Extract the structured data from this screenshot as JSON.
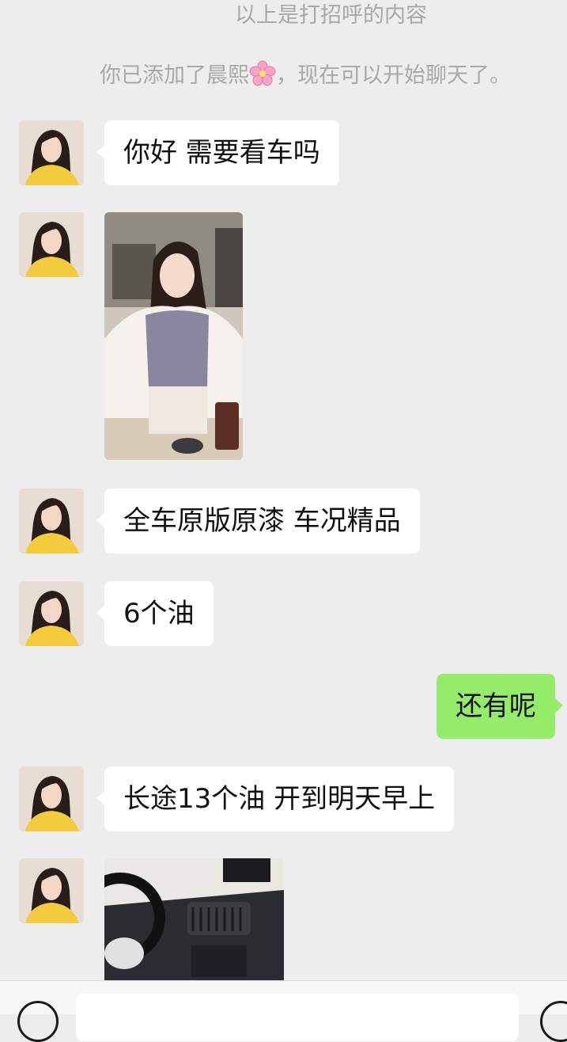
{
  "system": {
    "greeting_note": "以上是打招呼的内容",
    "added_prefix": "你已添加了晨熙",
    "added_emoji": "cherry-blossom-icon",
    "added_suffix": "，现在可以开始聊天了。"
  },
  "messages": [
    {
      "side": "left",
      "type": "text",
      "text": "你好  需要看车吗"
    },
    {
      "side": "left",
      "type": "image",
      "alt": "photo-woman-cafe"
    },
    {
      "side": "left",
      "type": "text",
      "text": "全车原版原漆  车况精品"
    },
    {
      "side": "left",
      "type": "text",
      "text": "6个油"
    },
    {
      "side": "right",
      "type": "text",
      "text": "还有呢"
    },
    {
      "side": "left",
      "type": "text",
      "text": "长途13个油  开到明天早上"
    },
    {
      "side": "left",
      "type": "image",
      "alt": "photo-car-interior"
    }
  ],
  "colors": {
    "background": "#ededed",
    "bubble_left": "#ffffff",
    "bubble_right": "#95ec69",
    "system_text": "#a8a8a8"
  },
  "bottom_bar": {
    "voice_icon": "voice-icon",
    "plus_icon": "plus-icon"
  }
}
